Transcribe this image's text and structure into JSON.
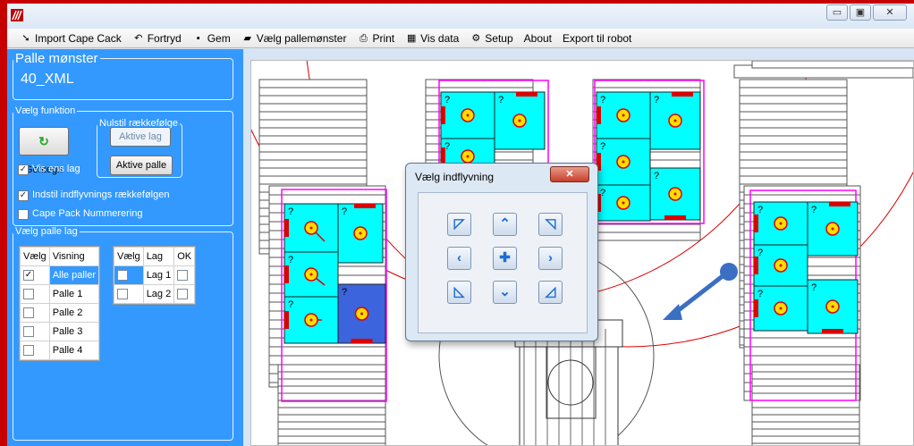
{
  "window": {
    "logo_icon": "app-logo-icon",
    "controls": [
      "minimize",
      "maximize",
      "close"
    ],
    "control_glyphs": [
      "▭",
      "▣",
      "✕"
    ]
  },
  "menu": {
    "items": [
      {
        "label": "Import Cape Cack",
        "icon": "import-icon",
        "glyph": "➘"
      },
      {
        "label": "Fortryd",
        "icon": "undo-icon",
        "glyph": "↶"
      },
      {
        "label": "Gem",
        "icon": "save-icon",
        "glyph": "▪"
      },
      {
        "label": "Vælg pallemønster",
        "icon": "open-folder-icon",
        "glyph": "▰"
      },
      {
        "label": "Print",
        "icon": "printer-icon",
        "glyph": "⎙"
      },
      {
        "label": "Vis data",
        "icon": "grid-icon",
        "glyph": "▦"
      },
      {
        "label": "Setup",
        "icon": "setup-icon",
        "glyph": "⚙"
      },
      {
        "label": "About",
        "icon": "",
        "glyph": ""
      },
      {
        "label": "Export til robot",
        "icon": "",
        "glyph": ""
      }
    ]
  },
  "pattern": {
    "legend": "Palle mønster",
    "name": "40_XML"
  },
  "funktion": {
    "legend": "Vælg funktion",
    "regen_label": "Gentegn",
    "reset_legend": "Nulstil rækkefølge",
    "aktive_lag_label": "Aktive lag",
    "aktive_palle_label": "Aktive palle",
    "vis_ens_lag": {
      "label": "Vis ens lag",
      "checked": true
    },
    "indstil": {
      "label": "Indstil indflyvnings rækkefølgen",
      "checked": true
    },
    "cape_pack": {
      "label": "Cape Pack Nummerering",
      "checked": false
    }
  },
  "layers": {
    "legend": "Vælg palle  lag",
    "pallets_headers": [
      "Vælg",
      "Visning"
    ],
    "pallets": [
      {
        "checked": true,
        "label": "Alle paller"
      },
      {
        "checked": false,
        "label": "Palle 1"
      },
      {
        "checked": false,
        "label": "Palle 2"
      },
      {
        "checked": false,
        "label": "Palle 3"
      },
      {
        "checked": false,
        "label": "Palle 4"
      }
    ],
    "lag_headers": [
      "Vælg",
      "Lag",
      "OK"
    ],
    "lag": [
      {
        "checked": false,
        "label": "Lag 1",
        "ok": false
      },
      {
        "checked": false,
        "label": "Lag 2",
        "ok": false
      }
    ]
  },
  "canvas": {
    "box_mark": "?",
    "colors": {
      "box": "#00ffff",
      "selected_box": "#3c64dc",
      "pallet_outline": "#ff00ff",
      "pad": "#dd0000",
      "target": "#ffdd00",
      "reach": "#dd0000"
    }
  },
  "dialog": {
    "title": "Vælg indflyvning",
    "close_glyph": "✕",
    "buttons": [
      {
        "name": "approach-top-left-icon",
        "glyph": "◸"
      },
      {
        "name": "approach-up-icon",
        "glyph": "⌃"
      },
      {
        "name": "approach-top-right-icon",
        "glyph": "◹"
      },
      {
        "name": "approach-left-icon",
        "glyph": "‹"
      },
      {
        "name": "approach-center-icon",
        "glyph": "✚"
      },
      {
        "name": "approach-right-icon",
        "glyph": "›"
      },
      {
        "name": "approach-bottom-left-icon",
        "glyph": "◺"
      },
      {
        "name": "approach-down-icon",
        "glyph": "⌄"
      },
      {
        "name": "approach-bottom-right-icon",
        "glyph": "◿"
      }
    ]
  }
}
